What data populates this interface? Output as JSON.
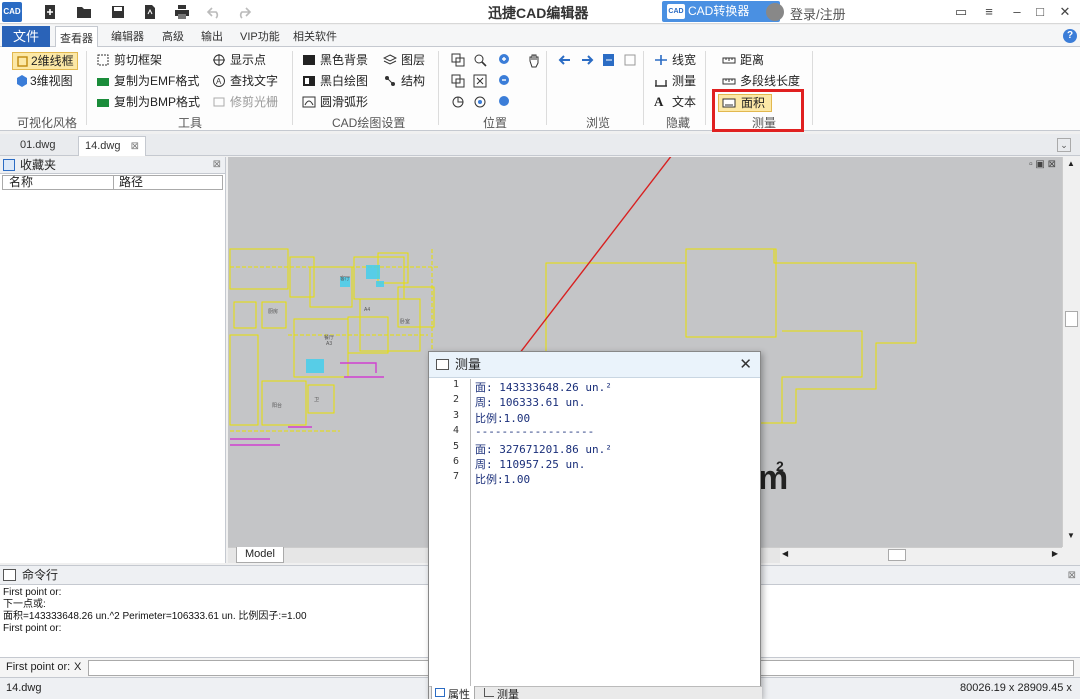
{
  "app": {
    "logo_text": "CAD",
    "title": "迅捷CAD编辑器",
    "convert_button": "CAD转换器",
    "login": "登录/注册"
  },
  "ribbon_tabs": {
    "file": "文件",
    "items": [
      "查看器",
      "编辑器",
      "高级",
      "输出",
      "VIP功能",
      "相关软件"
    ]
  },
  "ribbon": {
    "visual_style": {
      "wireframe2d": "2维线框",
      "view3d": "3维视图",
      "label": "可视化风格"
    },
    "tools": {
      "clip_frame": "剪切框架",
      "copy_emf": "复制为EMF格式",
      "copy_bmp": "复制为BMP格式",
      "show_point": "显示点",
      "find_text": "查找文字",
      "trim_raster": "修剪光栅",
      "label": "工具"
    },
    "cad_settings": {
      "black_bg": "黑色背景",
      "bw_draw": "黑白绘图",
      "smooth_arc": "圆滑弧形",
      "layers": "图层",
      "structure": "结构",
      "label": "CAD绘图设置"
    },
    "position": {
      "label": "位置"
    },
    "browse": {
      "label": "浏览"
    },
    "hide": {
      "line_width": "线宽",
      "measure": "测量",
      "text": "文本",
      "label": "隐藏"
    },
    "measure": {
      "distance": "距离",
      "polyline_length": "多段线长度",
      "area": "面积",
      "label": "测量"
    },
    "accent": "#e02020"
  },
  "doc_tabs": [
    "01.dwg",
    "14.dwg"
  ],
  "favorites": {
    "title": "收藏夹",
    "col_name": "名称",
    "col_path": "路径"
  },
  "canvas": {
    "model_tab": "Model",
    "unit_glyph": "m",
    "unit_sup": "2",
    "floor_labels": [
      "客厅",
      "A4",
      "卧室",
      "餐厅",
      "厨房",
      "卫",
      "A3",
      "阳台"
    ]
  },
  "command": {
    "title": "命令行",
    "output": [
      "First point or:",
      "下一点或:",
      "面积=143333648.26 un.^2 Perimeter=106333.61 un. 比例因子:=1.00",
      "First point or:"
    ],
    "prompt": "First point or:",
    "clear": "X"
  },
  "status": {
    "file": "14.dwg",
    "coords": "80026.19 x 28909.45 x 0"
  },
  "dialog": {
    "title": "测量",
    "line_numbers": [
      "1",
      "2",
      "3",
      "4",
      "5",
      "6",
      "7"
    ],
    "lines": [
      "面: 143333648.26 un.²",
      "周: 106333.61 un.",
      "比例:1.00",
      "------------------",
      "面: 327671201.86 un.²",
      "周: 110957.25 un.",
      "比例:1.00"
    ],
    "tab_properties": "属性",
    "tab_measure": "测量"
  }
}
